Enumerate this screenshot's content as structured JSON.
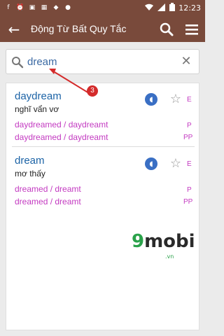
{
  "status_bar": {
    "time": "12:23",
    "icons": [
      "facebook-icon",
      "alarm-icon",
      "image-icon",
      "calendar-icon",
      "app-icon",
      "notification-icon",
      "wifi-icon",
      "signal-icon",
      "battery-icon"
    ]
  },
  "app_bar": {
    "title": "Động Từ Bất Quy Tắc",
    "back_icon": "arrow-left-icon",
    "search_icon": "search-icon",
    "menu_icon": "menu-icon",
    "color": "#794a3b"
  },
  "search": {
    "value": "dream",
    "clear_icon": "close-icon"
  },
  "results": [
    {
      "word": "daydream",
      "meaning": "nghĩ vẩn vơ",
      "past": "daydreamed / daydreamt",
      "past_participle": "daydreamed / daydreamt",
      "tag_base": "E",
      "tag_past": "P",
      "tag_pp": "PP"
    },
    {
      "word": "dream",
      "meaning": "mơ thấy",
      "past": "dreamed / dreamt",
      "past_participle": "dreamed / dreamt",
      "tag_base": "E",
      "tag_past": "P",
      "tag_pp": "PP"
    }
  ],
  "annotation": {
    "step": "3"
  },
  "watermark": {
    "brand": "mobi",
    "nine": "9",
    "domain": ".vn"
  },
  "colors": {
    "word": "#1c63a6",
    "form": "#c33ac1",
    "speaker": "#3a6fc4",
    "marker": "#d42b2b"
  }
}
